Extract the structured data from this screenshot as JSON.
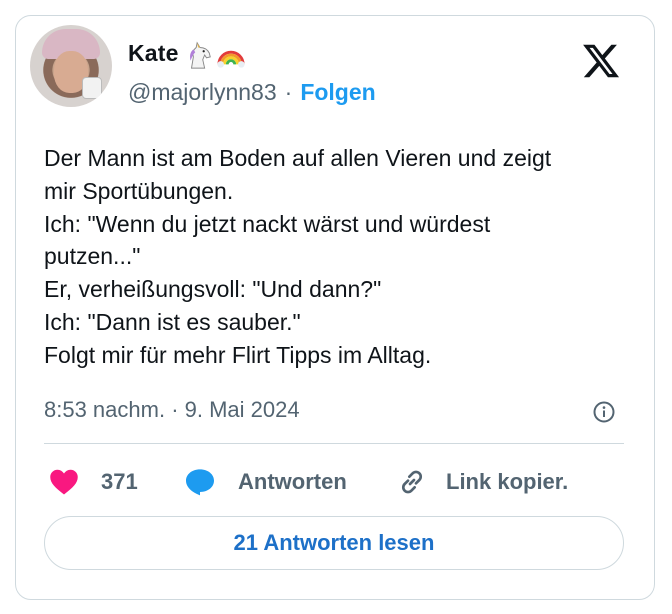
{
  "author": {
    "display_name": "Kate",
    "emojis": [
      "unicorn-icon",
      "rainbow-icon"
    ],
    "handle": "@majorlynn83",
    "separator": "·",
    "follow_label": "Folgen"
  },
  "tweet": {
    "lines": [
      "Der Mann ist am Boden auf allen Vieren und zeigt",
      "mir Sportübungen.",
      "Ich: \"Wenn du jetzt nackt wärst und würdest",
      "putzen...\"",
      "Er, verheißungsvoll: \"Und dann?\"",
      "Ich: \"Dann ist es sauber.\"",
      "Folgt mir für mehr Flirt Tipps im Alltag."
    ],
    "timestamp": "8:53 nachm. · 9. Mai 2024"
  },
  "actions": {
    "likes": "371",
    "reply_label": "Antworten",
    "copy_link_label": "Link kopier.",
    "read_replies_label": "21 Antworten lesen"
  },
  "colors": {
    "accent": "#1d9bf0",
    "heart": "#f91880",
    "reply_bubble": "#1d9bf0",
    "muted": "#536471"
  }
}
